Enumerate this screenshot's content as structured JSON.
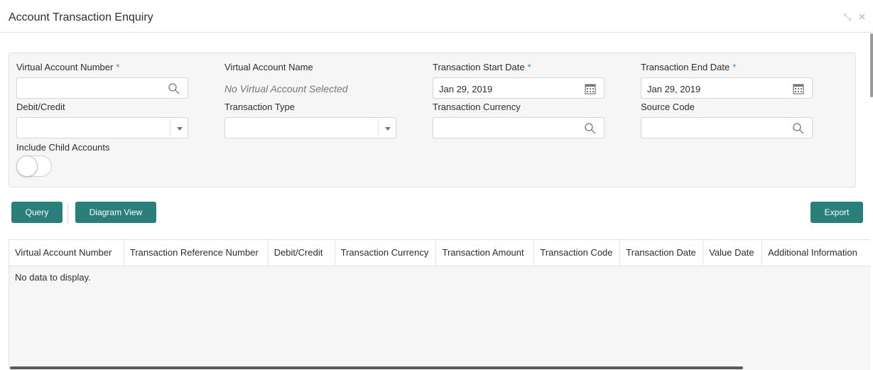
{
  "header": {
    "title": "Account Transaction Enquiry",
    "minimize_glyph": "⤡",
    "close_glyph": "✕"
  },
  "form": {
    "virtual_account_number": {
      "label": "Virtual Account Number",
      "required_mark": "*",
      "value": "",
      "icon": "search-icon"
    },
    "virtual_account_name": {
      "label": "Virtual Account Name",
      "value": "No Virtual Account Selected"
    },
    "transaction_start_date": {
      "label": "Transaction Start Date",
      "required_mark": "*",
      "value": "Jan 29, 2019",
      "icon": "calendar-icon"
    },
    "transaction_end_date": {
      "label": "Transaction End Date",
      "required_mark": "*",
      "value": "Jan 29, 2019",
      "icon": "calendar-icon"
    },
    "debit_credit": {
      "label": "Debit/Credit",
      "value": ""
    },
    "transaction_type": {
      "label": "Transaction Type",
      "value": ""
    },
    "transaction_currency": {
      "label": "Transaction Currency",
      "value": "",
      "icon": "search-icon"
    },
    "source_code": {
      "label": "Source Code",
      "value": "",
      "icon": "search-icon"
    },
    "include_child_accounts": {
      "label": "Include Child Accounts",
      "on": false
    }
  },
  "actions": {
    "query": "Query",
    "diagram_view": "Diagram View",
    "export": "Export"
  },
  "table": {
    "columns": [
      "Virtual Account Number",
      "Transaction Reference Number",
      "Debit/Credit",
      "Transaction Currency",
      "Transaction Amount",
      "Transaction Code",
      "Transaction Date",
      "Value Date",
      "Additional Information"
    ],
    "empty_message": "No data to display."
  },
  "colors": {
    "accent": "#2a7f7a",
    "required": "#3a88c8",
    "panel": "#f6f6f6"
  }
}
